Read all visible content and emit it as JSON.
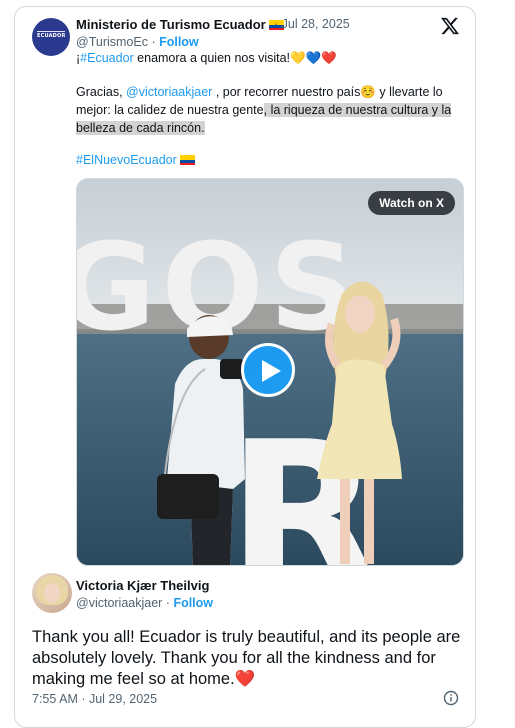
{
  "post": {
    "author_name": "Ministerio de Turismo Ecuador",
    "avatar_text": "ECUADOR",
    "flag_colors": [
      "#ffd100",
      "#034ea2",
      "#ed1c24"
    ],
    "date": "· Jul 28, 2025",
    "handle": "@TurismoEc",
    "handle_sep": " · ",
    "follow_label": "Follow",
    "line1_a": "¡",
    "line1_hashtag": "#Ecuador",
    "line1_b": " enamora a quien nos visita!",
    "line1_emoji": "💛💙❤️",
    "line2_a": "Gracias, ",
    "line2_mention": "@victoriaakjaer",
    "line2_b": " , por recorrer nuestro país",
    "line2_emoji": "☺️",
    "line2_c": " y llevarte lo",
    "line3_a": "mejor: la calidez de nuestra gente",
    "line3_hl": ", la riqueza de nuestra cultura y la",
    "line4_hl": "belleza de cada rincón.",
    "hashtag2": "#ElNuevoEcuador",
    "media_watch_label": "Watch on X",
    "media_sign_text": "GOS",
    "media_sign_letter": "R"
  },
  "quote": {
    "name": "Victoria Kjær Theilvig",
    "handle": "@victoriaakjaer",
    "handle_sep": " · ",
    "follow_label": "Follow",
    "text": "Thank you all! Ecuador is truly beautiful, and its people are absolutely lovely. Thank you for all the kindness and for making me feel so at home.",
    "heart": "❤️",
    "timestamp": "7:55 AM · Jul 29, 2025"
  },
  "colors": {
    "accent": "#1d9bf0",
    "text": "#0f1419",
    "muted": "#536471",
    "border": "#cfd9de"
  },
  "icons": {
    "brand": "x-logo-icon",
    "play": "play-icon",
    "info": "info-icon"
  }
}
